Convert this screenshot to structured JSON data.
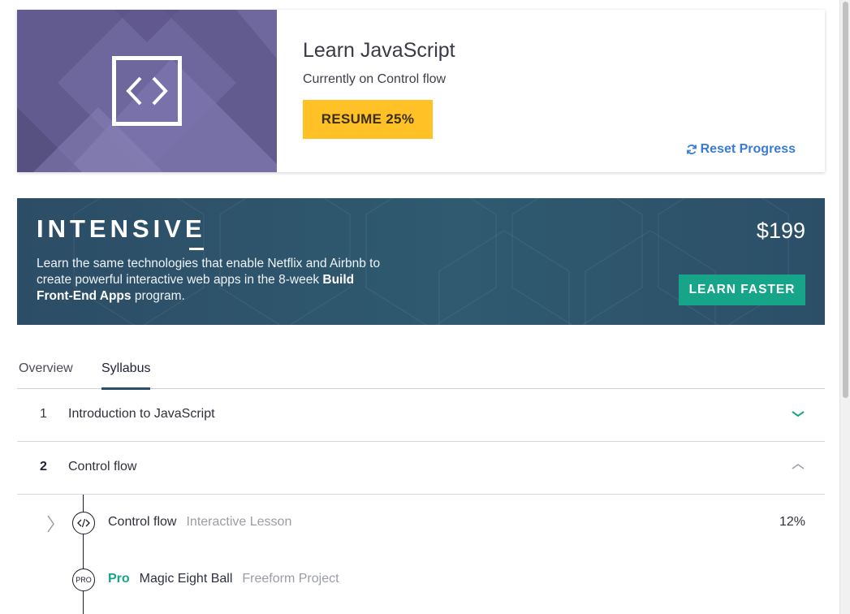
{
  "course": {
    "title": "Learn JavaScript",
    "subtitle": "Currently on Control flow",
    "resume_label": "RESUME 25%",
    "reset_label": "Reset Progress",
    "art_color": "#6b6499"
  },
  "banner": {
    "heading": "INTENSIVE",
    "price": "$199",
    "text_pre": "Learn the same technologies that enable Netflix and Airbnb to create powerful interactive web apps in the 8-week ",
    "text_bold": "Build Front-End Apps",
    "text_post": " program.",
    "cta_label": "LEARN FASTER",
    "cta_color": "#17a589"
  },
  "tabs": [
    {
      "label": "Overview",
      "active": false
    },
    {
      "label": "Syllabus",
      "active": true
    }
  ],
  "syllabus": [
    {
      "num": "1",
      "title": "Introduction to JavaScript",
      "expanded": false
    },
    {
      "num": "2",
      "title": "Control flow",
      "expanded": true
    }
  ],
  "lessons": [
    {
      "title": "Control flow",
      "type": "Interactive Lesson",
      "progress": "12%",
      "icon": "code-icon"
    },
    {
      "tag": "Pro",
      "icon_text": "PRO",
      "title": "Magic Eight Ball",
      "type": "Freeform Project",
      "icon": "pro-badge-icon"
    }
  ]
}
